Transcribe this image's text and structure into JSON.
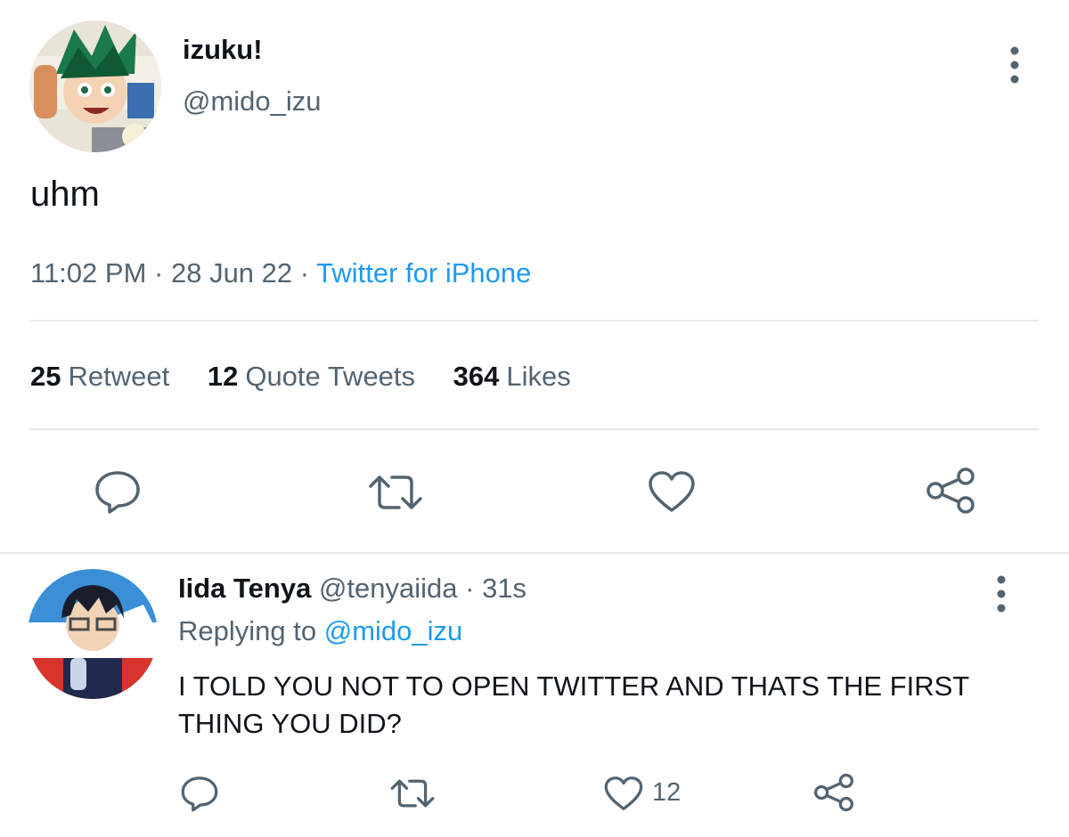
{
  "main_tweet": {
    "display_name": "izuku!",
    "handle": "@mido_izu",
    "text": "uhm",
    "time": "11:02 PM",
    "date": "28 Jun 22",
    "separator": "·",
    "source": "Twitter for iPhone",
    "stats": {
      "retweets_count": "25",
      "retweets_label": "Retweet",
      "quotes_count": "12",
      "quotes_label": "Quote Tweets",
      "likes_count": "364",
      "likes_label": "Likes"
    },
    "actions": [
      "reply-icon",
      "retweet-icon",
      "like-icon",
      "share-icon"
    ]
  },
  "reply": {
    "display_name": "Iida Tenya",
    "handle": "@tenyaiida",
    "separator": "·",
    "age": "31s",
    "replying_prefix": "Replying to",
    "replying_to": "@mido_izu",
    "text": "I TOLD YOU NOT TO OPEN TWITTER AND THATS THE FIRST THING YOU DID?",
    "like_count": "12",
    "actions": [
      "reply-icon",
      "retweet-icon",
      "like-icon",
      "share-icon"
    ]
  },
  "colors": {
    "text": "#0f1419",
    "secondary": "#536471",
    "link": "#1d9bf0",
    "divider": "#e6e9ec"
  }
}
